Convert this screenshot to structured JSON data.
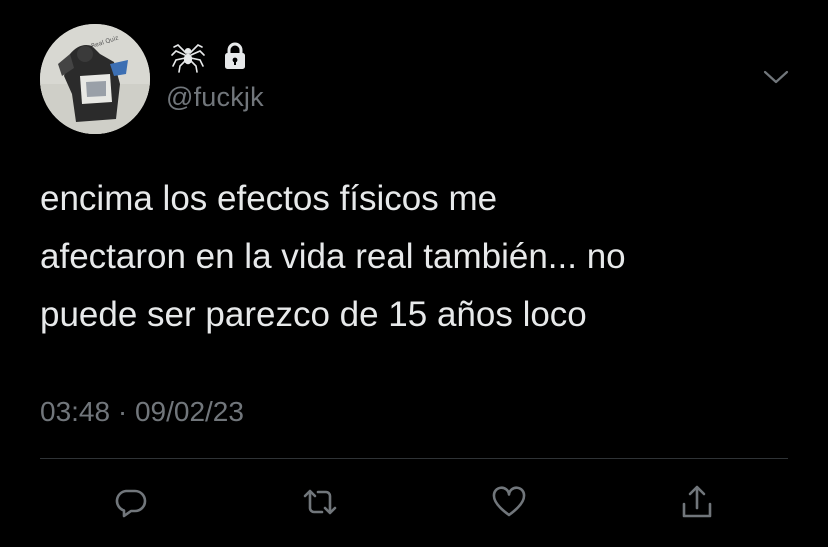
{
  "profile": {
    "handle": "@fuckjk",
    "name_icons": [
      "spider-icon",
      "lock-icon"
    ]
  },
  "tweet": {
    "text": "encima los efectos físicos me\nafectaron en la vida real también... no\npuede ser parezco de 15 años loco",
    "timestamp": "03:48 · 09/02/23"
  },
  "actions": {
    "icons": [
      "reply-icon",
      "retweet-icon",
      "like-icon",
      "share-icon"
    ]
  },
  "colors": {
    "background": "#000000",
    "text": "#e7e9ea",
    "secondary": "#71767b",
    "divider": "#2f3336"
  }
}
